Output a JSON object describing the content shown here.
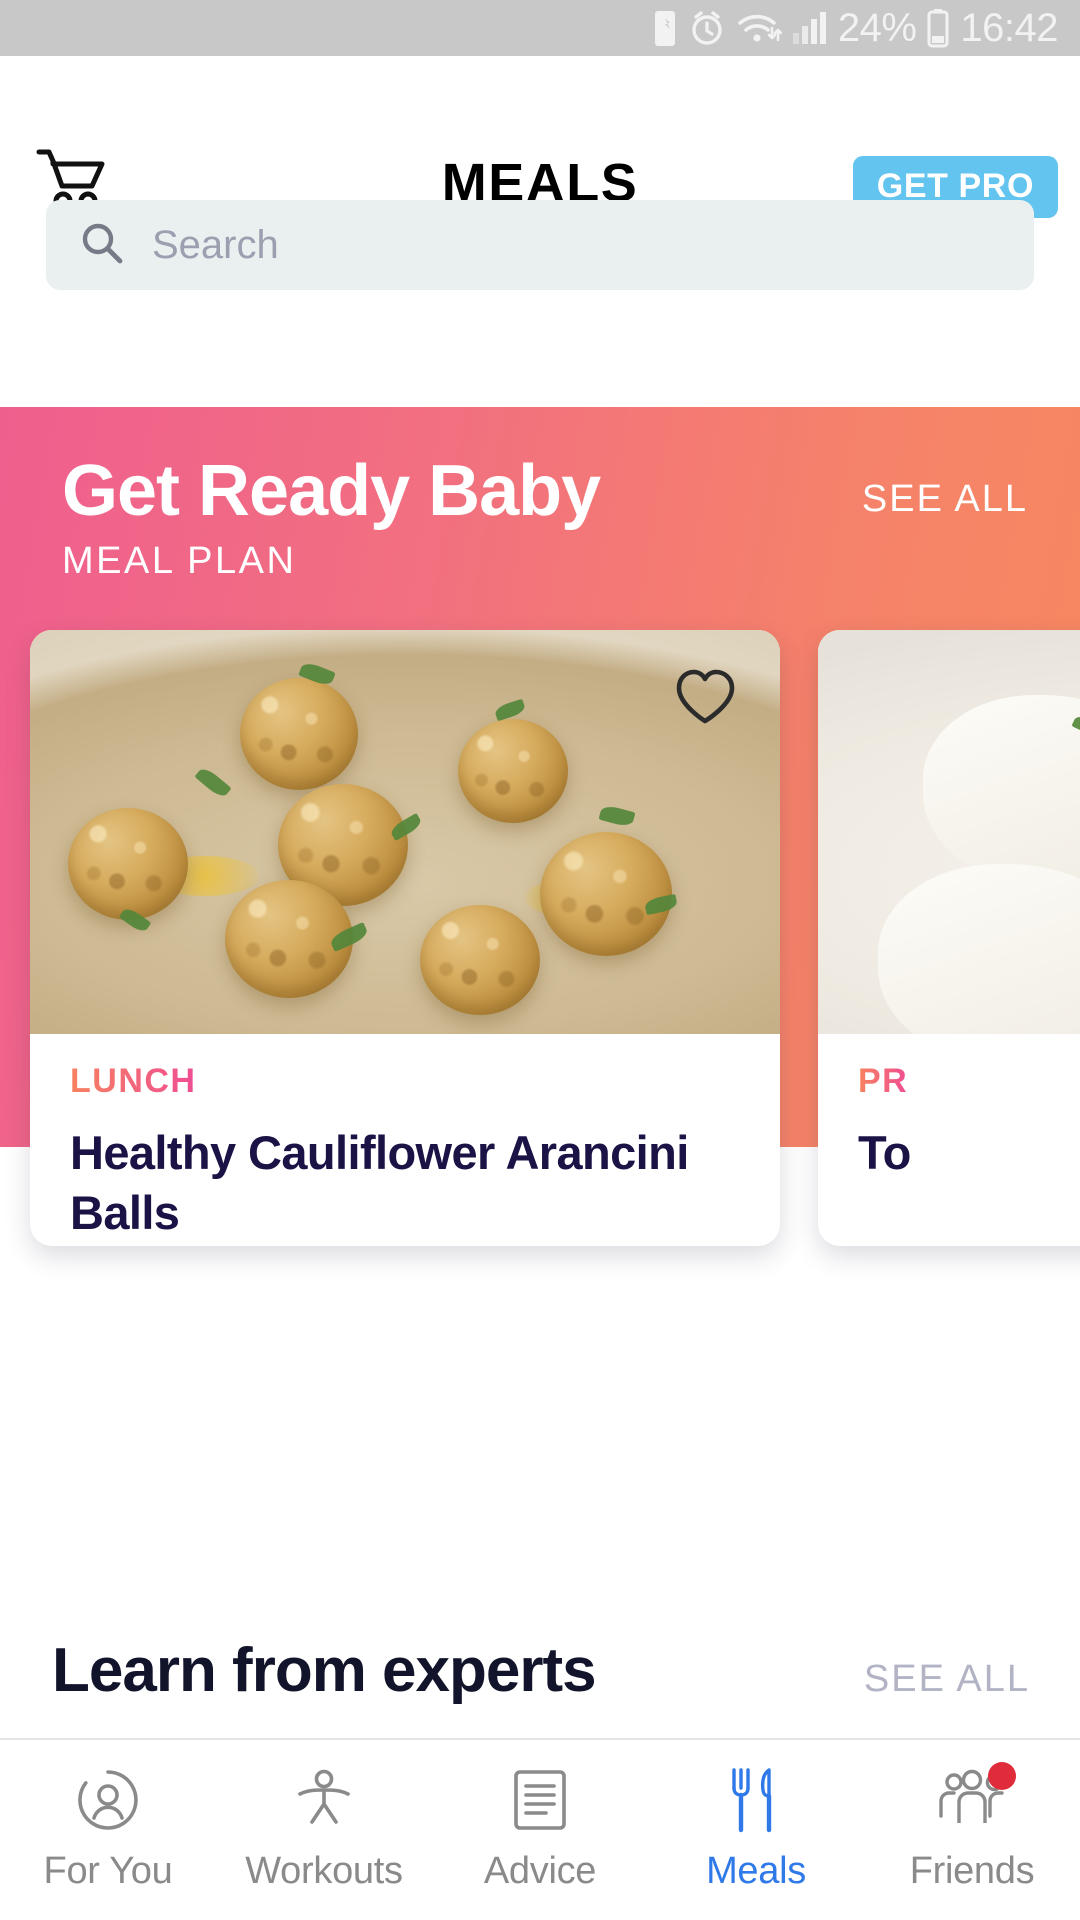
{
  "status_bar": {
    "battery_percent": "24%",
    "time": "16:42",
    "icons": [
      "battery-saver-icon",
      "alarm-icon",
      "wifi-icon",
      "signal-icon",
      "battery-icon"
    ]
  },
  "header": {
    "title": "MEALS",
    "cart_icon": "shopping-cart-icon",
    "pro_button": "GET PRO",
    "pro_button_color": "#62c4ef"
  },
  "search": {
    "placeholder": "Search",
    "value": "",
    "icon": "search-icon"
  },
  "banner": {
    "title": "Get Ready Baby",
    "subtitle": "MEAL PLAN",
    "see_all": "SEE ALL",
    "gradient_from": "#ef5f8e",
    "gradient_to": "#f7895f"
  },
  "meal_cards": [
    {
      "tag": "LUNCH",
      "name": "Healthy Cauliflower Arancini Balls",
      "favorite_icon": "heart-icon",
      "favorited": false
    },
    {
      "tag": "PR",
      "name": "To",
      "favorite_icon": "heart-icon",
      "favorited": false
    }
  ],
  "learn_section": {
    "title": "Learn from experts",
    "see_all": "SEE ALL"
  },
  "tabbar": {
    "active_color": "#2f79e8",
    "inactive_color": "#8a8a8a",
    "items": [
      {
        "label": "For You",
        "icon": "person-circle-icon",
        "active": false,
        "badge": false
      },
      {
        "label": "Workouts",
        "icon": "exercise-figure-icon",
        "active": false,
        "badge": false
      },
      {
        "label": "Advice",
        "icon": "document-lines-icon",
        "active": false,
        "badge": false
      },
      {
        "label": "Meals",
        "icon": "fork-knife-icon",
        "active": true,
        "badge": false
      },
      {
        "label": "Friends",
        "icon": "group-people-icon",
        "active": false,
        "badge": true
      }
    ]
  }
}
